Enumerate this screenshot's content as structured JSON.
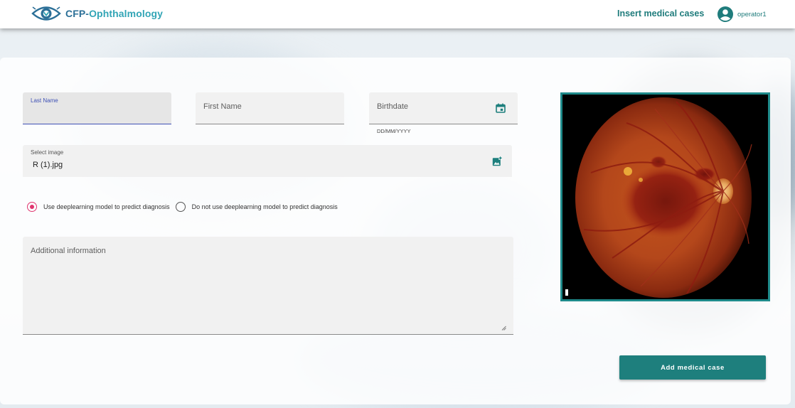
{
  "app": {
    "brand_prefix": "CFP-",
    "brand_suffix": "Ophthalmology",
    "logo_icon": "eye-logo-icon"
  },
  "header": {
    "nav_link": "Insert medical cases",
    "user_name": "operator1",
    "user_icon": "account-circle-icon"
  },
  "form": {
    "last_name": {
      "float_label": "Last Name",
      "value": ""
    },
    "first_name": {
      "label": "First Name",
      "value": ""
    },
    "birthdate": {
      "label": "Birthdate",
      "hint": "DD/MM/YYYY",
      "icon": "calendar-icon"
    },
    "image": {
      "label": "Select image",
      "value": "R (1).jpg",
      "icon": "add-photo-icon"
    },
    "diagnosis_options": [
      {
        "label": "Use deeplearning model to predict diagnosis",
        "checked": true
      },
      {
        "label": "Do not use deeplearning model to predict diagnosis",
        "checked": false
      }
    ],
    "additional_info": {
      "label": "Additional information",
      "value": ""
    },
    "submit_label": "Add medical case"
  },
  "preview": {
    "alt": "fundus image",
    "frame_color": "#1e8a8a"
  },
  "colors": {
    "accent": "#1e7f7d",
    "radio_checked": "#e0346e",
    "focus": "#3f51b5"
  }
}
